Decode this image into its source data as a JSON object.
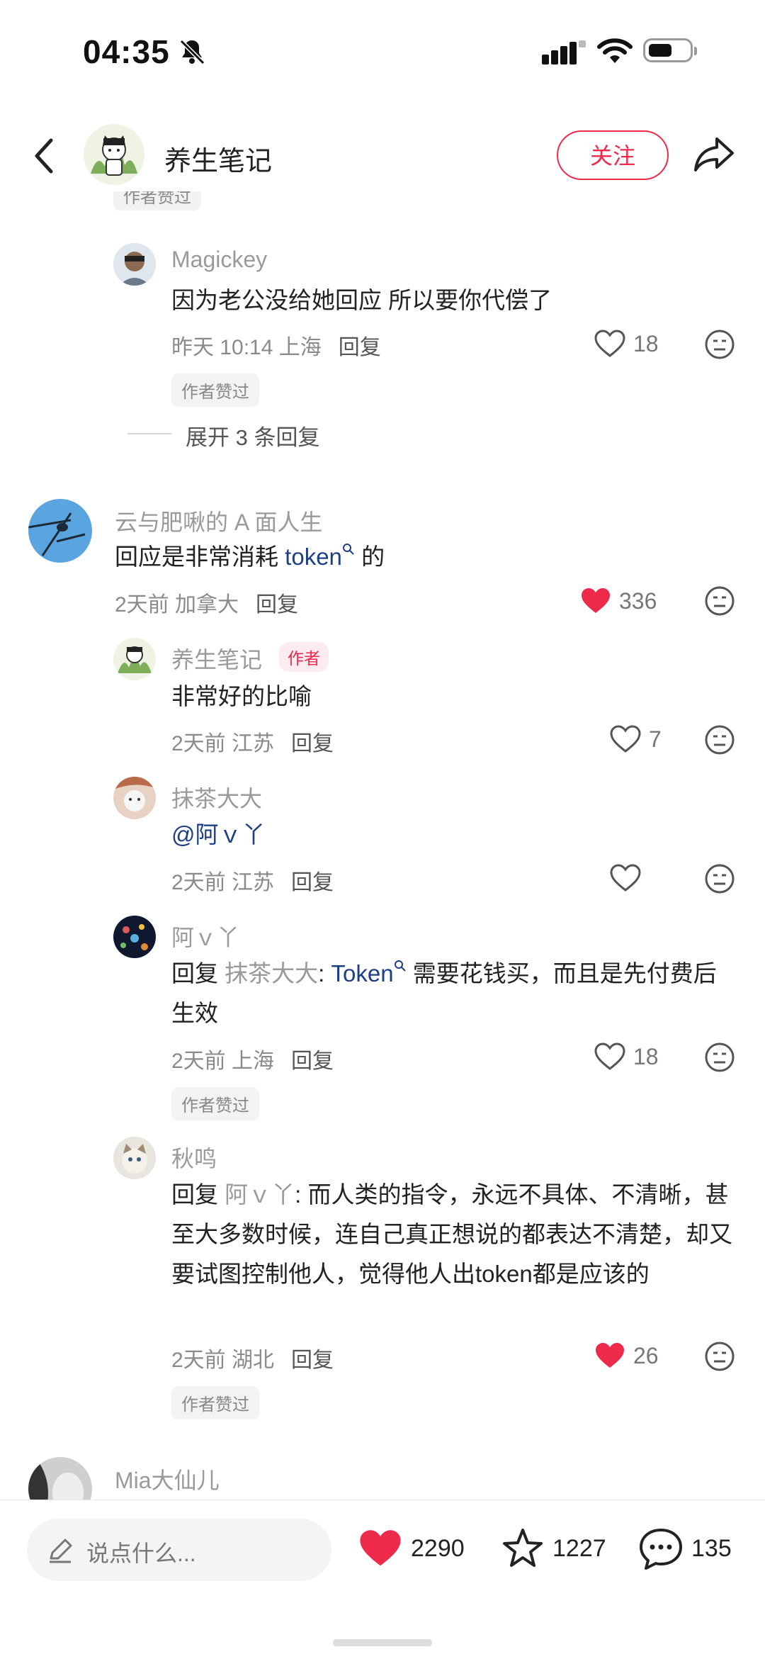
{
  "status": {
    "time": "04:35"
  },
  "header": {
    "title": "养生笔记",
    "follow_label": "关注"
  },
  "author_liked_label": "作者赞过",
  "comments": [
    {
      "name": "Magickey",
      "text": "因为老公没给她回应 所以要你代偿了",
      "time": "昨天 10:14",
      "location": "上海",
      "reply": "回复",
      "likes": "18"
    },
    {
      "expand": "展开 3 条回复"
    },
    {
      "name": "云与肥啾的 A 面人生",
      "text_pre": "回应是非常消耗 ",
      "text_link": "token",
      "text_post": " 的",
      "time": "2天前",
      "location": "加拿大",
      "reply": "回复",
      "likes": "336"
    },
    {
      "name": "养生笔记",
      "author_tag": "作者",
      "text": "非常好的比喻",
      "time": "2天前",
      "location": "江苏",
      "reply": "回复",
      "likes": "7"
    },
    {
      "name": "抹茶大大",
      "text": "@阿ｖ丫",
      "time": "2天前",
      "location": "江苏",
      "reply": "回复"
    },
    {
      "name": "阿ｖ丫",
      "reply_prefix": "回复 ",
      "reply_to": "抹茶大大",
      "colon": ": ",
      "text_link": "Token",
      "text_post": " 需要花钱买，而且是先付费后生效",
      "time": "2天前",
      "location": "上海",
      "reply": "回复",
      "likes": "18"
    },
    {
      "name": "秋鸣",
      "reply_prefix": "回复 ",
      "reply_to": "阿ｖ丫",
      "colon": ": ",
      "text": "而人类的指令，永远不具体、不清晰，甚至大多数时候，连自己真正想说的都表达不清楚，却又要试图控制他人，觉得他人出token都是应该的",
      "time": "2天前",
      "location": "湖北",
      "reply": "回复",
      "likes": "26"
    },
    {
      "name": "Mia大仙儿"
    }
  ],
  "bottom": {
    "input_placeholder": "说点什么...",
    "likes": "2290",
    "stars": "1227",
    "comments": "135"
  },
  "colors": {
    "accent": "#ee2a4b",
    "link": "#1e3f83"
  }
}
